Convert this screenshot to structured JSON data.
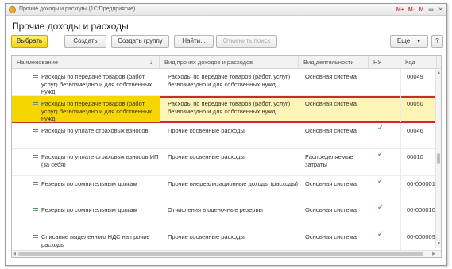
{
  "window": {
    "title": "Прочие доходы и расходы  (1С:Предприятие)",
    "controls": {
      "m_plus": "M+",
      "m_minus": "M-",
      "m": "M",
      "restore": "▭",
      "close": "✕"
    }
  },
  "heading": "Прочие доходы и расходы",
  "toolbar": {
    "select": "Выбрать",
    "create": "Создать",
    "create_group": "Создать группу",
    "find": "Найти...",
    "cancel_search": "Отменить поиск",
    "more": "Еще",
    "help": "?"
  },
  "columns": {
    "name": "Наименование",
    "kind": "Вид прочих доходов и расходов",
    "activity": "Вид деятельности",
    "nu": "НУ",
    "code": "Код"
  },
  "rows": [
    {
      "name": "Расходы по передаче товаров (работ, услуг) безвозмездно и для собственных нужд",
      "kind": "Расходы по передаче товаров (работ, услуг) безвозмездно и для собственных нужд",
      "activity": "Основная система",
      "nu": "",
      "code": "00049"
    },
    {
      "name": "Расходы по передаче товаров (работ, услуг) безвозмездно и для собственных нужд",
      "kind": "Расходы по передаче товаров (работ, услуг) безвозмездно и для собственных нужд",
      "activity": "Основная система",
      "nu": "",
      "code": "00050"
    },
    {
      "name": "Расходы по уплате страховых взносов",
      "kind": "Прочие косвенные расходы",
      "activity": "Основная система",
      "nu": "✓",
      "code": "00046"
    },
    {
      "name": "Расходы по уплате страховых взносов ИП (за себя)",
      "kind": "Прочие косвенные расходы",
      "activity": "Распределяемые затраты",
      "nu": "✓",
      "code": "00010"
    },
    {
      "name": "Резервы по сомнительным долгам",
      "kind": "Прочие внереализационные доходы (расходы)",
      "activity": "Основная система",
      "nu": "✓",
      "code": "00-000001"
    },
    {
      "name": "Резервы по сомнительным долгам",
      "kind": "Отчисления в оценочные резервы",
      "activity": "Основная система",
      "nu": "✓",
      "code": "00-000010"
    },
    {
      "name": "Списание выделенного НДС на прочие расходы",
      "kind": "Прочие косвенные расходы",
      "activity": "Основная система",
      "nu": "✓",
      "code": "00-000009"
    }
  ],
  "selected_row_index": 1
}
